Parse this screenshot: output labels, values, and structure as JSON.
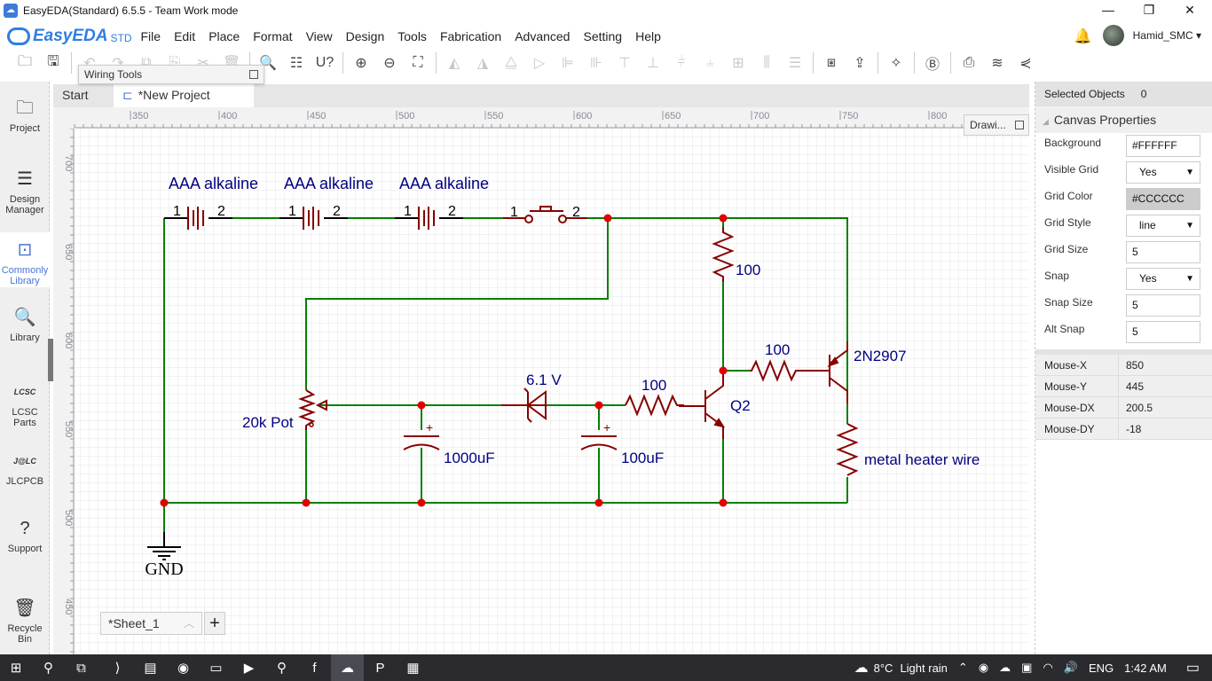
{
  "window": {
    "title": "EasyEDA(Standard) 6.5.5 - Team Work mode",
    "minimize": "—",
    "restore": "❐",
    "close": "✕"
  },
  "brand": {
    "name": "EasyEDA",
    "edition": "STD"
  },
  "menu": [
    "File",
    "Edit",
    "Place",
    "Format",
    "View",
    "Design",
    "Tools",
    "Fabrication",
    "Advanced",
    "Setting",
    "Help"
  ],
  "user": {
    "name": "Hamid_SMC ▾",
    "bell": "🔔"
  },
  "toolbar": {
    "groups": [
      [
        {
          "icon": "open-folder-icon",
          "glyph": "🗀",
          "enabled": true
        },
        {
          "icon": "save-icon",
          "glyph": "🖫",
          "enabled": true
        }
      ],
      [
        {
          "icon": "undo-icon",
          "glyph": "↶",
          "enabled": false
        },
        {
          "icon": "redo-icon",
          "glyph": "↷",
          "enabled": false
        },
        {
          "icon": "copy-icon",
          "glyph": "⧉",
          "enabled": false
        },
        {
          "icon": "paste-icon",
          "glyph": "⎘",
          "enabled": false
        },
        {
          "icon": "cut-icon",
          "glyph": "✂",
          "enabled": false
        },
        {
          "icon": "delete-icon",
          "glyph": "🗑",
          "enabled": false
        }
      ],
      [
        {
          "icon": "find-icon",
          "glyph": "🔍",
          "enabled": true
        },
        {
          "icon": "find-similar-icon",
          "glyph": "☷",
          "enabled": true
        },
        {
          "icon": "annotate-icon",
          "glyph": "U?",
          "enabled": true
        }
      ],
      [
        {
          "icon": "zoom-in-icon",
          "glyph": "⊕",
          "enabled": true
        },
        {
          "icon": "zoom-out-icon",
          "glyph": "⊖",
          "enabled": true
        },
        {
          "icon": "fit-icon",
          "glyph": "⛶",
          "enabled": true
        }
      ],
      [
        {
          "icon": "rotate-left-icon",
          "glyph": "◭",
          "enabled": false
        },
        {
          "icon": "rotate-right-icon",
          "glyph": "◮",
          "enabled": false
        },
        {
          "icon": "flip-h-icon",
          "glyph": "⧋",
          "enabled": false
        },
        {
          "icon": "flip-v-icon",
          "glyph": "▷",
          "enabled": false
        },
        {
          "icon": "align-left-icon",
          "glyph": "⊫",
          "enabled": false
        },
        {
          "icon": "align-right-icon",
          "glyph": "⊪",
          "enabled": false
        },
        {
          "icon": "align-top-icon",
          "glyph": "⊤",
          "enabled": false
        },
        {
          "icon": "align-bottom-icon",
          "glyph": "⊥",
          "enabled": false
        },
        {
          "icon": "align-center-h-icon",
          "glyph": "⫩",
          "enabled": false
        },
        {
          "icon": "align-center-v-icon",
          "glyph": "⫨",
          "enabled": false
        },
        {
          "icon": "grid-align-icon",
          "glyph": "⊞",
          "enabled": false
        },
        {
          "icon": "distribute-h-icon",
          "glyph": "⫼",
          "enabled": false
        },
        {
          "icon": "distribute-v-icon",
          "glyph": "☰",
          "enabled": false
        }
      ],
      [
        {
          "icon": "simulate-icon",
          "glyph": "⧆",
          "enabled": true
        },
        {
          "icon": "convert-pcb-icon",
          "glyph": "⇪",
          "enabled": true
        }
      ],
      [
        {
          "icon": "design-check-icon",
          "glyph": "✧",
          "enabled": true
        }
      ],
      [
        {
          "icon": "bom-icon",
          "glyph": "Ⓑ",
          "enabled": true
        }
      ],
      [
        {
          "icon": "export-icon",
          "glyph": "⎙",
          "enabled": true
        },
        {
          "icon": "layers-icon",
          "glyph": "≋",
          "enabled": true
        },
        {
          "icon": "share-icon",
          "glyph": "⋞",
          "enabled": true
        }
      ]
    ]
  },
  "wiring_tools": {
    "title": "Wiring Tools"
  },
  "drawing_tools": {
    "title": "Drawi..."
  },
  "leftnav": [
    {
      "label": "Project",
      "icon": "folder-icon",
      "glyph": "🗀"
    },
    {
      "label": "Design Manager",
      "icon": "design-manager-icon",
      "glyph": "☰"
    },
    {
      "label": "Commonly Library",
      "icon": "chip-icon",
      "glyph": "⊡",
      "active": true
    },
    {
      "label": "Library",
      "icon": "library-search-icon",
      "glyph": "🔍"
    },
    {
      "label": "LCSC Parts",
      "icon": "lcsc-icon",
      "glyph": "LCSC"
    },
    {
      "label": "JLCPCB",
      "icon": "jlc-icon",
      "glyph": "J@LC"
    },
    {
      "label": "Support",
      "icon": "support-icon",
      "glyph": "?"
    },
    {
      "label": "Recycle Bin",
      "icon": "trash-icon",
      "glyph": "🗑"
    }
  ],
  "tabs": [
    {
      "label": "Start"
    },
    {
      "label": "*New Project",
      "active": true
    }
  ],
  "rulers": {
    "top": [
      "350",
      "400",
      "450",
      "500",
      "550",
      "600",
      "650",
      "700",
      "750",
      "800"
    ],
    "left": [
      "700",
      "650",
      "600",
      "550",
      "500",
      "450"
    ]
  },
  "schematic": {
    "battery_labels": [
      "AAA alkaline",
      "AAA alkaline",
      "AAA alkaline"
    ],
    "pin1": "1",
    "pin2": "2",
    "r_top": "100",
    "r_base_pnp": "100",
    "r_base_npn": "100",
    "pnp": "2N2907",
    "npn": "Q2",
    "zener": "6.1 V",
    "pot": "20k Pot",
    "c1": "1000uF",
    "c2": "100uF",
    "heater": "metal heater wire",
    "gnd": "GND",
    "plus": "+",
    "colors": {
      "wire": "#008000",
      "part": "#880000",
      "junction": "#e00000",
      "text": "#000080"
    }
  },
  "sheets": {
    "current": "*Sheet_1",
    "add": "+"
  },
  "right_panel": {
    "selected_label": "Selected Objects",
    "selected_value": "0",
    "section": "Canvas Properties",
    "props": [
      {
        "label": "Background",
        "value": "#FFFFFF",
        "type": "text"
      },
      {
        "label": "Visible Grid",
        "value": "Yes",
        "type": "select"
      },
      {
        "label": "Grid Color",
        "value": "#CCCCCC",
        "type": "color"
      },
      {
        "label": "Grid Style",
        "value": "line",
        "type": "select"
      },
      {
        "label": "Grid Size",
        "value": "5",
        "type": "text"
      },
      {
        "label": "Snap",
        "value": "Yes",
        "type": "select"
      },
      {
        "label": "Snap Size",
        "value": "5",
        "type": "text"
      },
      {
        "label": "Alt Snap",
        "value": "5",
        "type": "text"
      }
    ],
    "mouse": [
      {
        "label": "Mouse-X",
        "value": "850"
      },
      {
        "label": "Mouse-Y",
        "value": "445"
      },
      {
        "label": "Mouse-DX",
        "value": "200.5"
      },
      {
        "label": "Mouse-DY",
        "value": "-18"
      }
    ]
  },
  "taskbar": {
    "apps": [
      {
        "name": "start-icon",
        "glyph": "⊞"
      },
      {
        "name": "search-icon",
        "glyph": "⚲"
      },
      {
        "name": "task-view-icon",
        "glyph": "⧉"
      },
      {
        "name": "vscode-icon",
        "glyph": "⟩"
      },
      {
        "name": "monitor-app-icon",
        "glyph": "▤"
      },
      {
        "name": "firefox-icon",
        "glyph": "◉"
      },
      {
        "name": "file-explorer-icon",
        "glyph": "▭"
      },
      {
        "name": "media-player-icon",
        "glyph": "▶"
      },
      {
        "name": "search-app-icon",
        "glyph": "⚲"
      },
      {
        "name": "foxit-icon",
        "glyph": "f"
      },
      {
        "name": "easyeda-icon",
        "glyph": "☁",
        "active": true
      },
      {
        "name": "powerpoint-icon",
        "glyph": "P"
      },
      {
        "name": "calendar-app-icon",
        "glyph": "▦"
      }
    ],
    "weather_temp": "8°C",
    "weather_desc": "Light rain",
    "lang": "ENG",
    "time": "1:42 AM"
  }
}
